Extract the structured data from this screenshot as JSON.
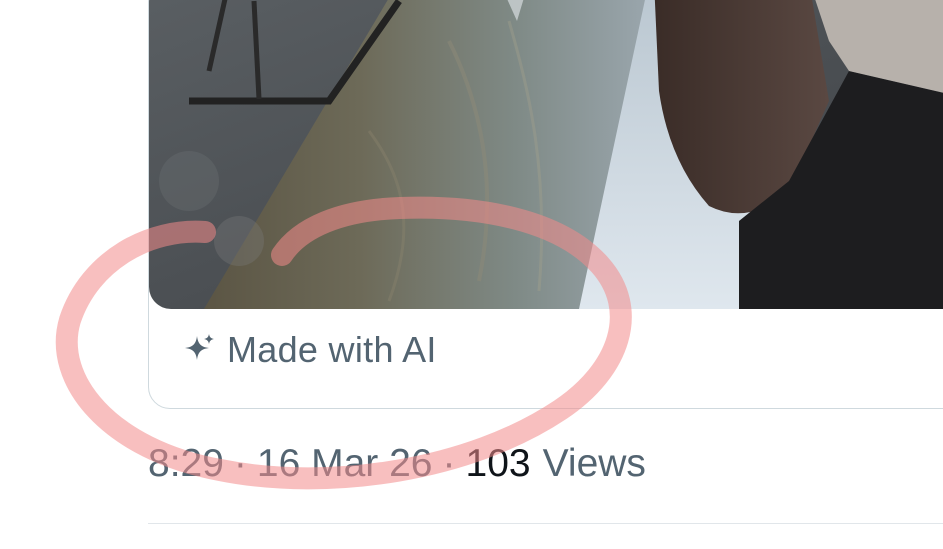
{
  "media": {
    "ai_label": "Made with AI",
    "ai_icon": "sparkle-icon"
  },
  "meta": {
    "time": "8:29",
    "separator": "·",
    "date": "16 Mar 26",
    "views_count": "103",
    "views_label": "Views"
  },
  "annotation": {
    "color": "#f28b8b"
  }
}
